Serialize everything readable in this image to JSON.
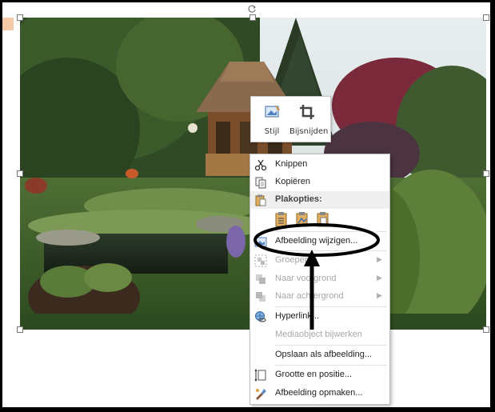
{
  "mini_toolbar": {
    "style_label": "Stijl",
    "crop_label": "Bijsnijden"
  },
  "context_menu": {
    "cut": "Knippen",
    "copy": "Kopiëren",
    "paste_options": "Plakopties:",
    "change_picture": "Afbeelding wijzigen...",
    "group": "Groeperen",
    "bring_forward": "Naar voorgrond",
    "send_backward": "Naar achtergrond",
    "hyperlink": "Hyperlink...",
    "edit_media": "Mediaobject bijwerken",
    "save_as_picture": "Opslaan als afbeelding...",
    "size_position": "Grootte en positie...",
    "format_picture": "Afbeelding opmaken..."
  },
  "icons": {
    "cut": "scissors-icon",
    "copy": "copy-icon",
    "paste": "clipboard-icon",
    "change_picture": "picture-icon",
    "group": "group-icon",
    "bring_forward": "bring-forward-icon",
    "send_backward": "send-backward-icon",
    "hyperlink": "globe-link-icon",
    "size_position": "size-position-icon",
    "format_picture": "format-picture-icon"
  },
  "colors": {
    "highlight_ellipse": "#000000",
    "arrow": "#000000",
    "menu_background": "#ffffff",
    "disabled_text": "#a8a8a8"
  }
}
